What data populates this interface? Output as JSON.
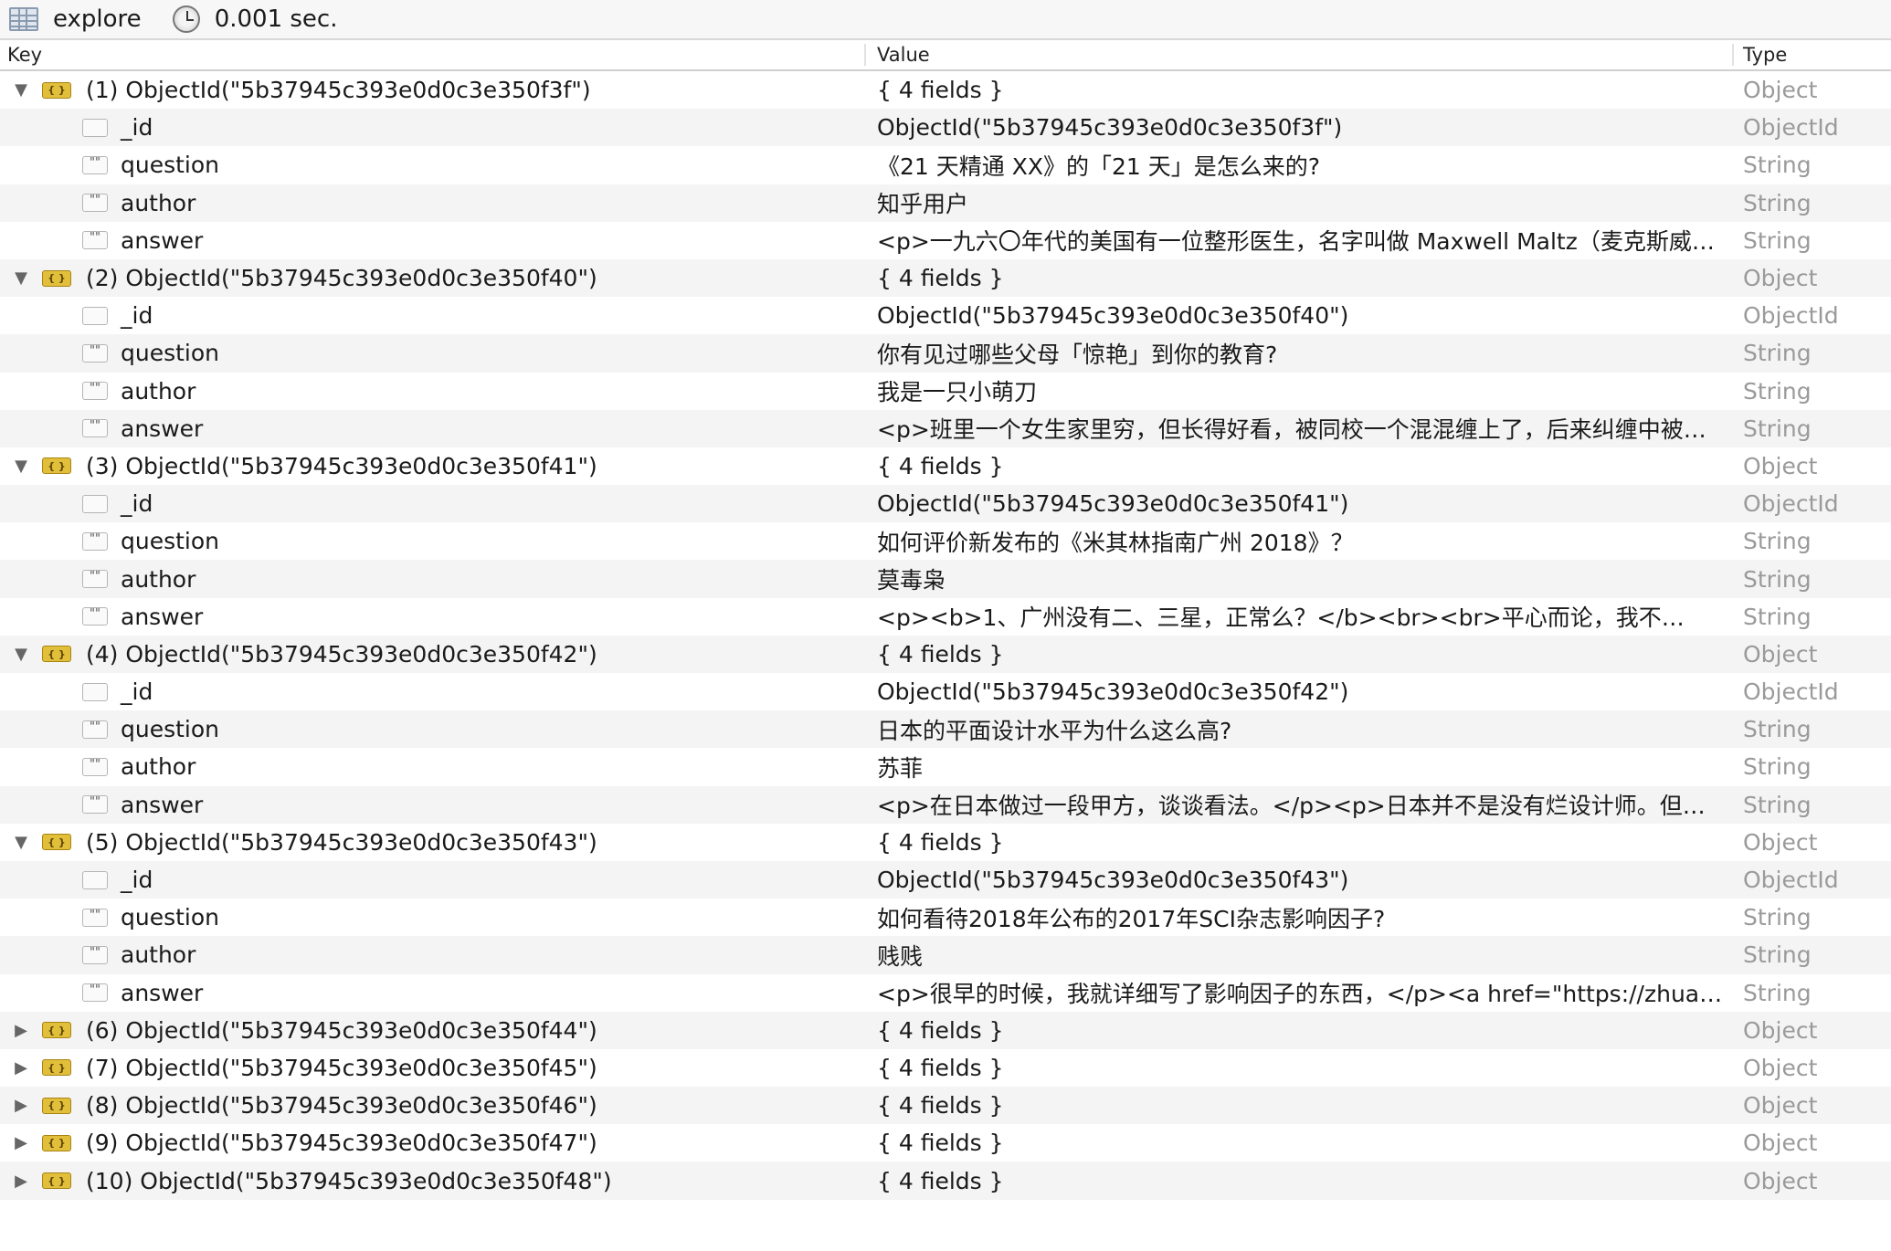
{
  "toolbar": {
    "view_label": "explore",
    "view_icon": "table-grid-icon",
    "timer_icon": "clock-icon",
    "elapsed": "0.001 sec."
  },
  "columns": {
    "key": "Key",
    "value": "Value",
    "type": "Type"
  },
  "rows": [
    {
      "kind": "doc",
      "expanded": true,
      "key": "(1) ObjectId(\"5b37945c393e0d0c3e350f3f\")",
      "value": "{ 4 fields }",
      "type": "Object"
    },
    {
      "kind": "field",
      "icon": "",
      "key": "_id",
      "value": "ObjectId(\"5b37945c393e0d0c3e350f3f\")",
      "type": "ObjectId"
    },
    {
      "kind": "field",
      "icon": "\"\"",
      "key": "question",
      "value": "《21 天精通 XX》的「21 天」是怎么来的?",
      "type": "String"
    },
    {
      "kind": "field",
      "icon": "\"\"",
      "key": "author",
      "value": "知乎用户",
      "type": "String"
    },
    {
      "kind": "field",
      "icon": "\"\"",
      "key": "answer",
      "value": "<p>一九六〇年代的美国有一位整形医生，名字叫做 Maxwell Maltz（麦克斯威…",
      "type": "String"
    },
    {
      "kind": "doc",
      "expanded": true,
      "key": "(2) ObjectId(\"5b37945c393e0d0c3e350f40\")",
      "value": "{ 4 fields }",
      "type": "Object"
    },
    {
      "kind": "field",
      "icon": "",
      "key": "_id",
      "value": "ObjectId(\"5b37945c393e0d0c3e350f40\")",
      "type": "ObjectId"
    },
    {
      "kind": "field",
      "icon": "\"\"",
      "key": "question",
      "value": "你有见过哪些父母「惊艳」到你的教育?",
      "type": "String"
    },
    {
      "kind": "field",
      "icon": "\"\"",
      "key": "author",
      "value": "我是一只小萌刀",
      "type": "String"
    },
    {
      "kind": "field",
      "icon": "\"\"",
      "key": "answer",
      "value": "<p>班里一个女生家里穷，但长得好看，被同校一个混混缠上了，后来纠缠中被…",
      "type": "String"
    },
    {
      "kind": "doc",
      "expanded": true,
      "key": "(3) ObjectId(\"5b37945c393e0d0c3e350f41\")",
      "value": "{ 4 fields }",
      "type": "Object"
    },
    {
      "kind": "field",
      "icon": "",
      "key": "_id",
      "value": "ObjectId(\"5b37945c393e0d0c3e350f41\")",
      "type": "ObjectId"
    },
    {
      "kind": "field",
      "icon": "\"\"",
      "key": "question",
      "value": "如何评价新发布的《米其林指南广州 2018》？",
      "type": "String"
    },
    {
      "kind": "field",
      "icon": "\"\"",
      "key": "author",
      "value": "莫毒枭",
      "type": "String"
    },
    {
      "kind": "field",
      "icon": "\"\"",
      "key": "answer",
      "value": "<p><b>1、广州没有二、三星，正常么？</b><br><br>平心而论，我不…",
      "type": "String"
    },
    {
      "kind": "doc",
      "expanded": true,
      "key": "(4) ObjectId(\"5b37945c393e0d0c3e350f42\")",
      "value": "{ 4 fields }",
      "type": "Object"
    },
    {
      "kind": "field",
      "icon": "",
      "key": "_id",
      "value": "ObjectId(\"5b37945c393e0d0c3e350f42\")",
      "type": "ObjectId"
    },
    {
      "kind": "field",
      "icon": "\"\"",
      "key": "question",
      "value": "日本的平面设计水平为什么这么高?",
      "type": "String"
    },
    {
      "kind": "field",
      "icon": "\"\"",
      "key": "author",
      "value": "苏菲",
      "type": "String"
    },
    {
      "kind": "field",
      "icon": "\"\"",
      "key": "answer",
      "value": "<p>在日本做过一段甲方，谈谈看法。</p><p>日本并不是没有烂设计师。但…",
      "type": "String"
    },
    {
      "kind": "doc",
      "expanded": true,
      "key": "(5) ObjectId(\"5b37945c393e0d0c3e350f43\")",
      "value": "{ 4 fields }",
      "type": "Object"
    },
    {
      "kind": "field",
      "icon": "",
      "key": "_id",
      "value": "ObjectId(\"5b37945c393e0d0c3e350f43\")",
      "type": "ObjectId"
    },
    {
      "kind": "field",
      "icon": "\"\"",
      "key": "question",
      "value": "如何看待2018年公布的2017年SCI杂志影响因子?",
      "type": "String"
    },
    {
      "kind": "field",
      "icon": "\"\"",
      "key": "author",
      "value": "贱贱",
      "type": "String"
    },
    {
      "kind": "field",
      "icon": "\"\"",
      "key": "answer",
      "value": "<p>很早的时候，我就详细写了影响因子的东西，</p><a href=\"https://zhuan…",
      "type": "String"
    },
    {
      "kind": "doc",
      "expanded": false,
      "key": "(6) ObjectId(\"5b37945c393e0d0c3e350f44\")",
      "value": "{ 4 fields }",
      "type": "Object"
    },
    {
      "kind": "doc",
      "expanded": false,
      "key": "(7) ObjectId(\"5b37945c393e0d0c3e350f45\")",
      "value": "{ 4 fields }",
      "type": "Object"
    },
    {
      "kind": "doc",
      "expanded": false,
      "key": "(8) ObjectId(\"5b37945c393e0d0c3e350f46\")",
      "value": "{ 4 fields }",
      "type": "Object"
    },
    {
      "kind": "doc",
      "expanded": false,
      "key": "(9) ObjectId(\"5b37945c393e0d0c3e350f47\")",
      "value": "{ 4 fields }",
      "type": "Object"
    },
    {
      "kind": "doc",
      "expanded": false,
      "key": "(10) ObjectId(\"5b37945c393e0d0c3e350f48\")",
      "value": "{ 4 fields }",
      "type": "Object"
    }
  ],
  "icons": {
    "expanded": "▼",
    "collapsed": "▶",
    "object": "{ }"
  }
}
